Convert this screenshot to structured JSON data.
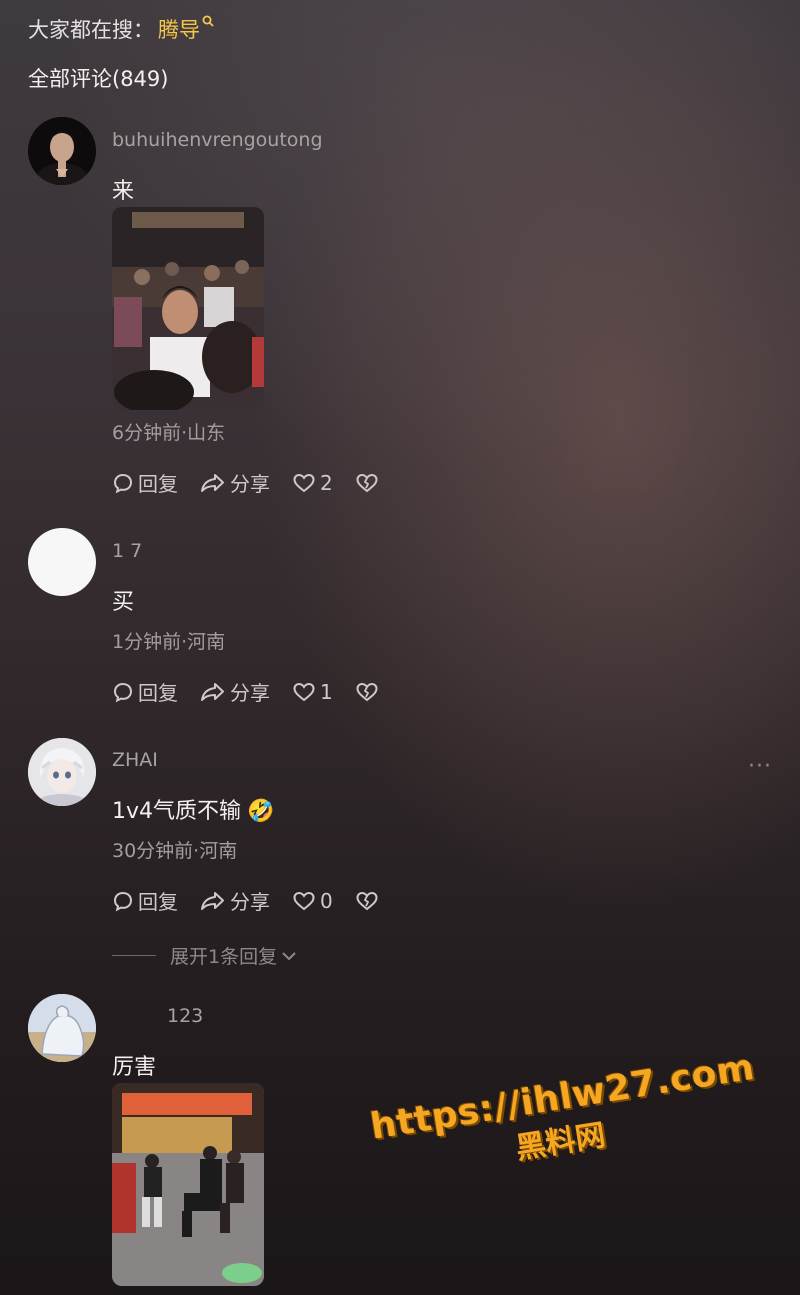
{
  "search": {
    "label": "大家都在搜：",
    "keyword": "腾导"
  },
  "header": {
    "title": "全部评论(849)"
  },
  "comments": [
    {
      "username": "buhuihenvrengoutong",
      "text": "来",
      "meta": "6分钟前·山东",
      "reply_label": "回复",
      "share_label": "分享",
      "likes": "2",
      "has_image": true,
      "avatar": "man-avatar-dark"
    },
    {
      "username": "1 7",
      "text": "买",
      "meta": "1分钟前·河南",
      "reply_label": "回复",
      "share_label": "分享",
      "likes": "1",
      "avatar": "blank-white-avatar"
    },
    {
      "username": "ZHAI",
      "text": "1v4气质不输",
      "emoji": "🤣",
      "meta": "30分钟前·河南",
      "reply_label": "回复",
      "share_label": "分享",
      "likes": "0",
      "more_label": "···",
      "avatar": "anime-avatar"
    },
    {
      "username": "123",
      "text": "厉害",
      "has_image": true,
      "avatar": "sketch-avatar"
    }
  ],
  "expand_replies": "展开1条回复",
  "watermark": {
    "line1": "https://ihlw27.com",
    "line2": "黑料网"
  },
  "colors": {
    "accent": "#f5c84a",
    "watermark": "#f5a623",
    "muted": "#a49d9e"
  }
}
